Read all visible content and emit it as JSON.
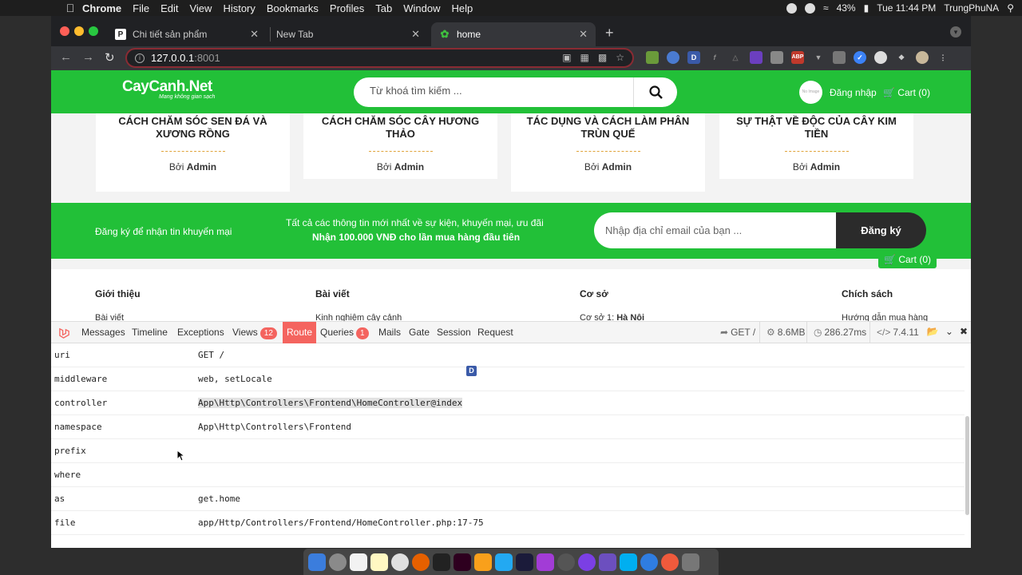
{
  "menubar": {
    "app": "Chrome",
    "items": [
      "File",
      "Edit",
      "View",
      "History",
      "Bookmarks",
      "Profiles",
      "Tab",
      "Window",
      "Help"
    ],
    "battery": "43%",
    "clock": "Tue 11:44 PM",
    "user": "TrungPhuNA"
  },
  "tabs": [
    {
      "title": "Chi tiết sản phẩm",
      "favicon": "P"
    },
    {
      "title": "New Tab",
      "favicon": ""
    },
    {
      "title": "home",
      "favicon": "leaf"
    }
  ],
  "address": {
    "host": "127.0.0.1",
    "port": ":8001"
  },
  "site": {
    "logo": "CayCanh.Net",
    "tagline": "Mang không gian sạch",
    "search_placeholder": "Từ khoá tìm kiếm ...",
    "avatar_text": "No Image",
    "login": "Đăng nhập",
    "cart": "Cart (0)"
  },
  "posts": [
    {
      "title": "CÁCH CHĂM SÓC SEN ĐÁ VÀ XƯƠNG RỒNG",
      "by": "Bởi",
      "author": "Admin"
    },
    {
      "title": "CÁCH CHĂM SÓC CÂY HƯƠNG THẢO",
      "by": "Bởi",
      "author": "Admin"
    },
    {
      "title": "TÁC DỤNG VÀ CÁCH LÀM PHÂN TRÙN QUẾ",
      "by": "Bởi",
      "author": "Admin"
    },
    {
      "title": "SỰ THẬT VỀ ĐỘC CỦA CÂY KIM TIỀN",
      "by": "Bởi",
      "author": "Admin"
    }
  ],
  "newsletter": {
    "label": "Đăng ký để nhận tin khuyến mại",
    "info_line1": "Tất cả các thông tin mới nhất về sự kiện, khuyến mại, ưu đãi",
    "info_line2": "Nhận 100.000 VNĐ cho lần mua hàng đầu tiên",
    "email_placeholder": "Nhập địa chỉ email của bạn ...",
    "submit": "Đăng ký",
    "floating_cart": "Cart (0)"
  },
  "footer": {
    "columns": [
      {
        "heading": "Giới thiệu",
        "link": "Bài viết"
      },
      {
        "heading": "Bài viết",
        "link": "Kinh nghiệm cây cảnh"
      },
      {
        "heading": "Cơ sở",
        "link_prefix": "Cơ sở 1:",
        "link_bold": "Hà Nội"
      },
      {
        "heading": "Chích sách",
        "link": "Hướng dẫn mua hàng"
      }
    ]
  },
  "debugbar": {
    "tabs": [
      {
        "label": "Messages"
      },
      {
        "label": "Timeline"
      },
      {
        "label": "Exceptions"
      },
      {
        "label": "Views",
        "badge": "12"
      },
      {
        "label": "Route",
        "active": true
      },
      {
        "label": "Queries",
        "badge": "1"
      },
      {
        "label": "Mails"
      },
      {
        "label": "Gate"
      },
      {
        "label": "Session"
      },
      {
        "label": "Request"
      }
    ],
    "method": "GET /",
    "memory": "8.6MB",
    "time": "286.27ms",
    "php": "7.4.11",
    "rows": [
      {
        "key": "uri",
        "value": "GET /"
      },
      {
        "key": "middleware",
        "value": "web, setLocale"
      },
      {
        "key": "controller",
        "value": "App\\Http\\Controllers\\Frontend\\HomeController@index"
      },
      {
        "key": "namespace",
        "value": "App\\Http\\Controllers\\Frontend"
      },
      {
        "key": "prefix",
        "value": ""
      },
      {
        "key": "where",
        "value": ""
      },
      {
        "key": "as",
        "value": "get.home"
      },
      {
        "key": "file",
        "value": "app/Http/Controllers/Frontend/HomeController.php:17-75"
      }
    ],
    "marker": "D"
  },
  "colors": {
    "brand": "#22c038",
    "debug_accent": "#f4645f"
  }
}
